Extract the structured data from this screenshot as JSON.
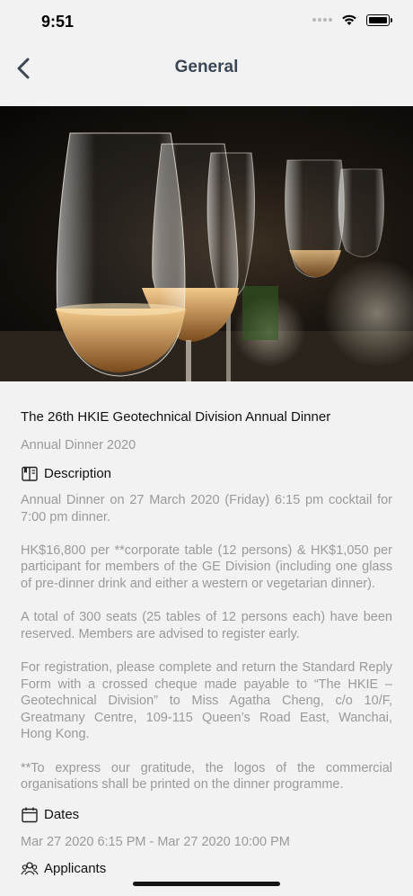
{
  "status_bar": {
    "time": "9:51"
  },
  "nav": {
    "title": "General"
  },
  "event": {
    "title": "The 26th HKIE Geotechnical Division Annual Dinner",
    "subtitle": "Annual Dinner 2020",
    "description_label": "Description",
    "description_paragraphs": [
      "Annual Dinner on 27 March 2020 (Friday) 6:15 pm cocktail for 7:00 pm dinner.",
      "HK$16,800 per **corporate table (12 persons) & HK$1,050 per participant for members of the GE Division (including one glass of pre-dinner drink and either a western or vegetarian dinner).",
      "A total of 300 seats (25 tables of 12 persons each) have been reserved.  Members are advised to register early.",
      "For registration, please complete and return the Standard Reply Form with a crossed cheque made payable to “The HKIE – Geotechnical Division” to Miss Agatha Cheng, c/o 10/F, Greatmany Centre, 109-115 Queen’s Road East, Wanchai, Hong Kong.",
      "**To express our gratitude, the logos of the commercial organisations shall be printed on the dinner programme."
    ],
    "dates_label": "Dates",
    "dates_value": "Mar 27 2020 6:15 PM - Mar 27 2020 10:00 PM",
    "applicants_label": "Applicants"
  }
}
